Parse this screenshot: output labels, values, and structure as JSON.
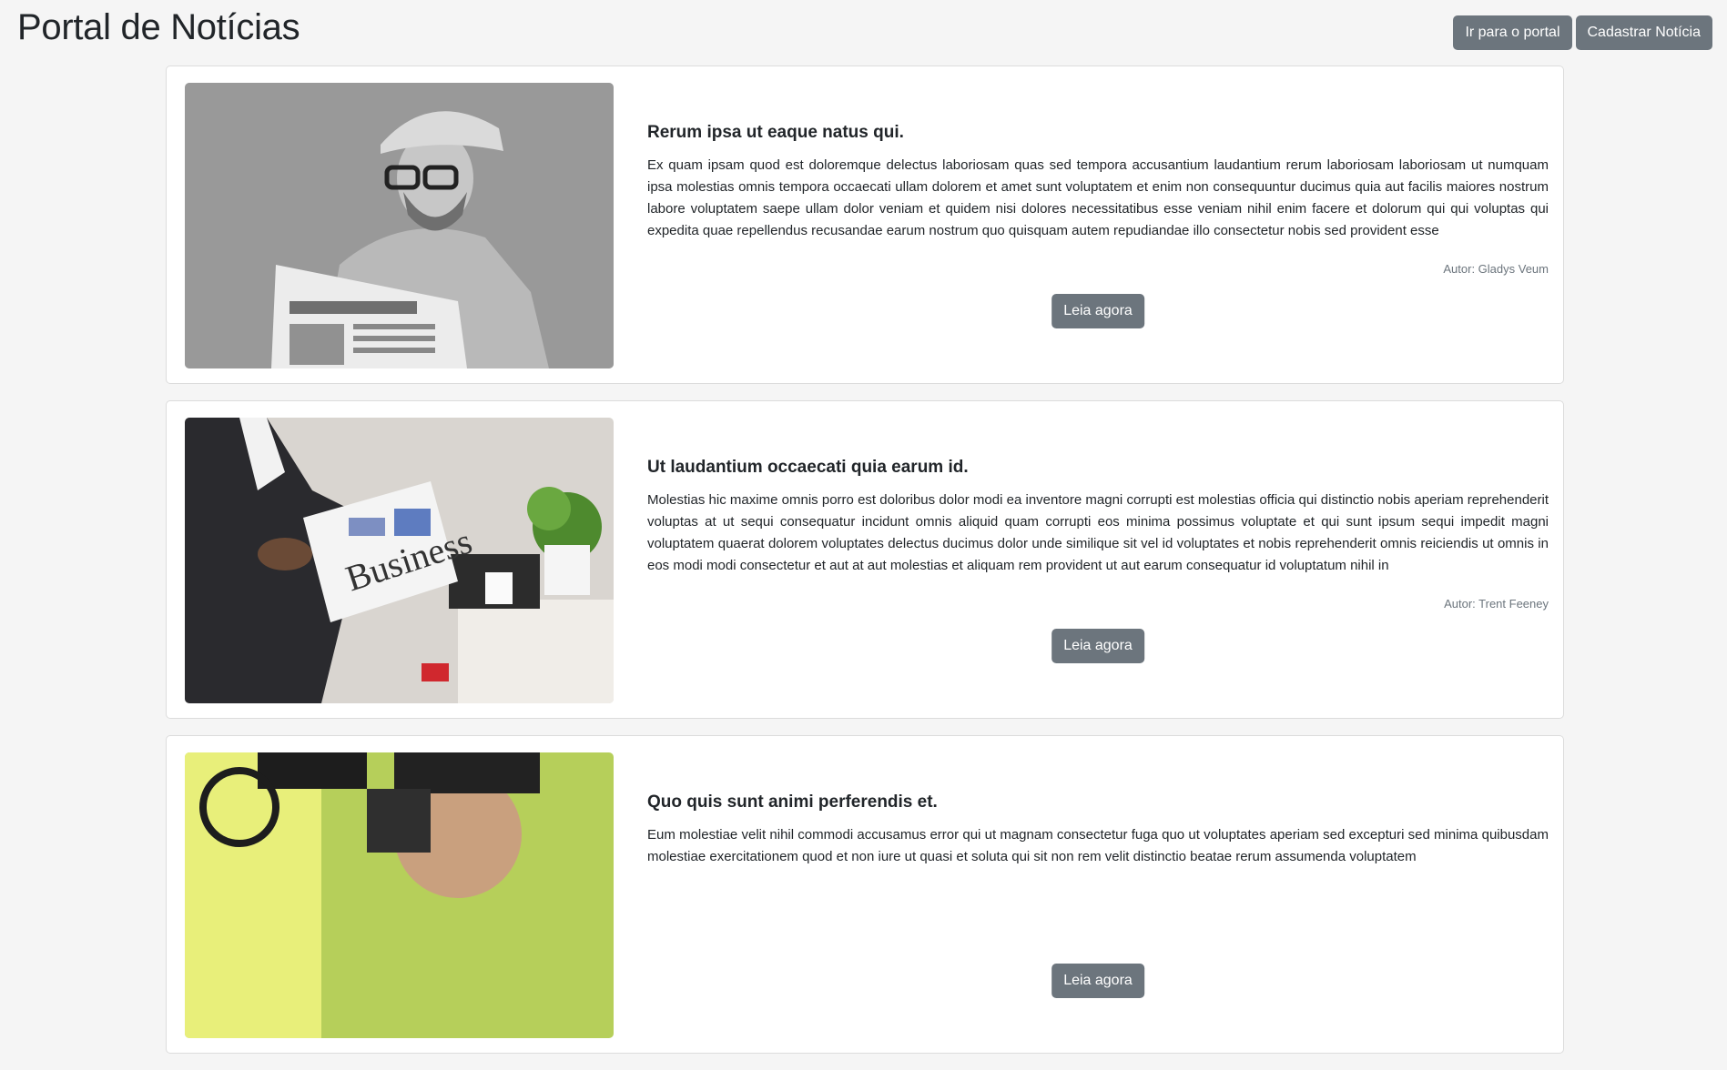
{
  "header": {
    "title": "Portal de Notícias",
    "portal_button": "Ir para o portal",
    "register_button": "Cadastrar Notícia"
  },
  "news": [
    {
      "title": "Rerum ipsa ut eaque natus qui.",
      "text": "Ex quam ipsam quod est doloremque delectus laboriosam quas sed tempora accusantium laudantium rerum laboriosam laboriosam ut numquam ipsa molestias omnis tempora occaecati ullam dolorem et amet sunt voluptatem et enim non consequuntur ducimus quia aut facilis maiores nostrum labore voluptatem saepe ullam dolor veniam et quidem nisi dolores necessitatibus esse veniam nihil enim facere et dolorum qui qui voluptas qui expedita quae repellendus recusandae earum nostrum quo quisquam autem repudiandae illo consectetur nobis sed provident esse",
      "author": "Autor: Gladys Veum",
      "button": "Leia agora",
      "image": "man-reading-newspaper-grayscale"
    },
    {
      "title": "Ut laudantium occaecati quia earum id.",
      "text": "Molestias hic maxime omnis porro est doloribus dolor modi ea inventore magni corrupti est molestias officia qui distinctio nobis aperiam reprehenderit voluptas at ut sequi consequatur incidunt omnis aliquid quam corrupti eos minima possimus voluptate et qui sunt ipsum sequi impedit magni voluptatem quaerat dolorem voluptates delectus ducimus dolor unde similique sit vel id voluptates et nobis reprehenderit omnis reiciendis ut omnis in eos modi modi consectetur et aut at aut molestias et aliquam rem provident ut aut earum consequatur id voluptatum nihil in",
      "author": "Autor: Trent Feeney",
      "button": "Leia agora",
      "image": "business-newspaper-reader"
    },
    {
      "title": "Quo quis sunt animi perferendis et.",
      "text": "Eum molestiae velit nihil commodi accusamus error qui ut magnam consectetur fuga quo ut voluptates aperiam sed excepturi sed minima quibusdam molestiae exercitationem quod et non iure ut quasi et soluta qui sit non rem velit distinctio beatae rerum assumenda voluptatem",
      "author": "",
      "button": "Leia agora",
      "image": "camera-operator-green"
    }
  ],
  "colors": {
    "background": "#f5f5f5",
    "button": "#6c757d",
    "card_border": "#dcdcdc"
  }
}
